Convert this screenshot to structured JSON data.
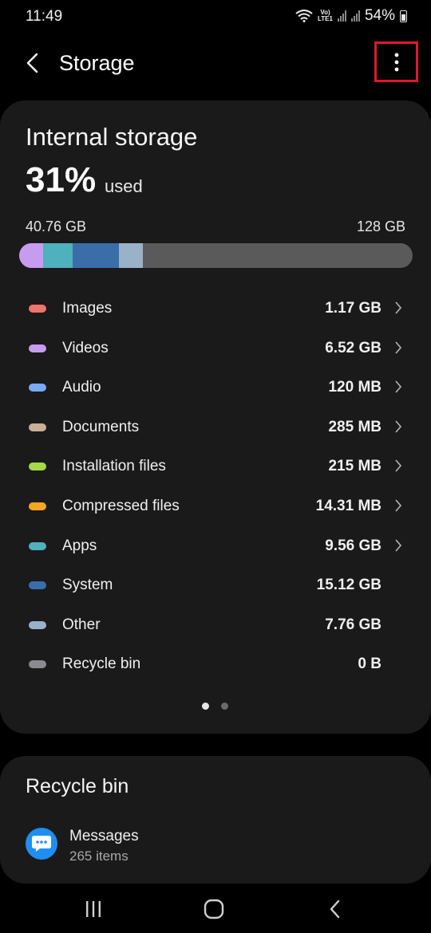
{
  "status_bar": {
    "time": "11:49",
    "volte": "Vo)",
    "lte": "LTE1",
    "battery": "54%",
    "icons": [
      "wifi-icon",
      "volte-lte-icon",
      "signal-icon",
      "signal-icon",
      "battery-icon"
    ]
  },
  "header": {
    "title": "Storage",
    "back_icon": "back-arrow-icon",
    "more_icon": "more-options-icon",
    "highlight_color": "#e0182d"
  },
  "internal_storage": {
    "title": "Internal storage",
    "percent": "31%",
    "used_label": "used",
    "used_amount": "40.76 GB",
    "total_amount": "128 GB",
    "usage_fraction": 0.31,
    "bar_segments": [
      {
        "category": "Videos",
        "color": "#c79cf0",
        "fraction": 0.061
      },
      {
        "category": "Apps",
        "color": "#4fb1bd",
        "fraction": 0.075
      },
      {
        "category": "System",
        "color": "#3b6ea8",
        "fraction": 0.118
      },
      {
        "category": "Other",
        "color": "#9ab2c8",
        "fraction": 0.061
      }
    ],
    "bar_track_color": "#5a5a5a"
  },
  "categories": [
    {
      "label": "Images",
      "size": "1.17 GB",
      "color": "#f0736e",
      "has_chevron": true
    },
    {
      "label": "Videos",
      "size": "6.52 GB",
      "color": "#c79cf0",
      "has_chevron": true
    },
    {
      "label": "Audio",
      "size": "120 MB",
      "color": "#7aa9f5",
      "has_chevron": true
    },
    {
      "label": "Documents",
      "size": "285 MB",
      "color": "#c9b094",
      "has_chevron": true
    },
    {
      "label": "Installation files",
      "size": "215 MB",
      "color": "#a6d84a",
      "has_chevron": true
    },
    {
      "label": "Compressed files",
      "size": "14.31 MB",
      "color": "#f5a623",
      "has_chevron": true
    },
    {
      "label": "Apps",
      "size": "9.56 GB",
      "color": "#4fb1bd",
      "has_chevron": true
    },
    {
      "label": "System",
      "size": "15.12 GB",
      "color": "#3b6ea8",
      "has_chevron": false
    },
    {
      "label": "Other",
      "size": "7.76 GB",
      "color": "#9ab2c8",
      "has_chevron": false
    },
    {
      "label": "Recycle bin",
      "size": "0 B",
      "color": "#8a8a8f",
      "has_chevron": false
    }
  ],
  "pager": {
    "pages": 2,
    "active": 1
  },
  "recycle_bin": {
    "title": "Recycle bin",
    "items": [
      {
        "app": "Messages",
        "count": "265 items",
        "icon": "messages-icon",
        "icon_color": "#1f8ef1"
      }
    ]
  },
  "nav_bar": {
    "buttons": [
      "recent-apps-icon",
      "home-icon",
      "back-icon"
    ]
  }
}
